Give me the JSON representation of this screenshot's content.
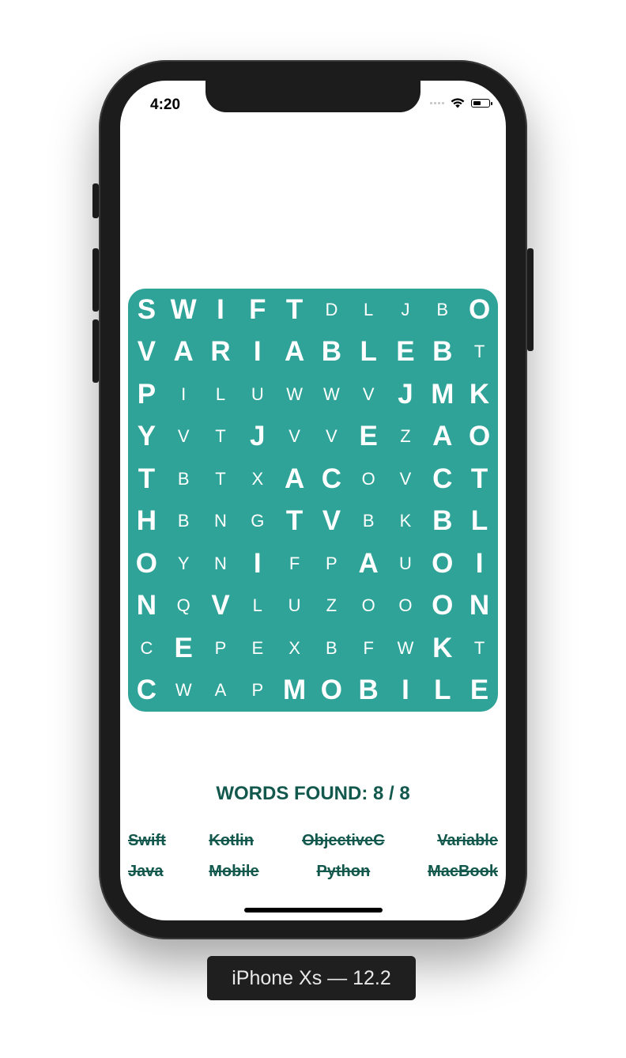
{
  "status_bar": {
    "time": "4:20"
  },
  "grid": [
    [
      {
        "l": "S",
        "f": true
      },
      {
        "l": "W",
        "f": true
      },
      {
        "l": "I",
        "f": true
      },
      {
        "l": "F",
        "f": true
      },
      {
        "l": "T",
        "f": true
      },
      {
        "l": "D",
        "f": false
      },
      {
        "l": "L",
        "f": false
      },
      {
        "l": "J",
        "f": false
      },
      {
        "l": "B",
        "f": false
      },
      {
        "l": "O",
        "f": true
      }
    ],
    [
      {
        "l": "V",
        "f": true
      },
      {
        "l": "A",
        "f": true
      },
      {
        "l": "R",
        "f": true
      },
      {
        "l": "I",
        "f": true
      },
      {
        "l": "A",
        "f": true
      },
      {
        "l": "B",
        "f": true
      },
      {
        "l": "L",
        "f": true
      },
      {
        "l": "E",
        "f": true
      },
      {
        "l": "B",
        "f": true
      },
      {
        "l": "T",
        "f": false
      }
    ],
    [
      {
        "l": "P",
        "f": true
      },
      {
        "l": "I",
        "f": false
      },
      {
        "l": "L",
        "f": false
      },
      {
        "l": "U",
        "f": false
      },
      {
        "l": "W",
        "f": false
      },
      {
        "l": "W",
        "f": false
      },
      {
        "l": "V",
        "f": false
      },
      {
        "l": "J",
        "f": true
      },
      {
        "l": "M",
        "f": true
      },
      {
        "l": "K",
        "f": true
      }
    ],
    [
      {
        "l": "Y",
        "f": true
      },
      {
        "l": "V",
        "f": false
      },
      {
        "l": "T",
        "f": false
      },
      {
        "l": "J",
        "f": true
      },
      {
        "l": "V",
        "f": false
      },
      {
        "l": "V",
        "f": false
      },
      {
        "l": "E",
        "f": true
      },
      {
        "l": "Z",
        "f": false
      },
      {
        "l": "A",
        "f": true
      },
      {
        "l": "O",
        "f": true
      }
    ],
    [
      {
        "l": "T",
        "f": true
      },
      {
        "l": "B",
        "f": false
      },
      {
        "l": "T",
        "f": false
      },
      {
        "l": "X",
        "f": false
      },
      {
        "l": "A",
        "f": true
      },
      {
        "l": "C",
        "f": true
      },
      {
        "l": "O",
        "f": false
      },
      {
        "l": "V",
        "f": false
      },
      {
        "l": "C",
        "f": true
      },
      {
        "l": "T",
        "f": true
      }
    ],
    [
      {
        "l": "H",
        "f": true
      },
      {
        "l": "B",
        "f": false
      },
      {
        "l": "N",
        "f": false
      },
      {
        "l": "G",
        "f": false
      },
      {
        "l": "T",
        "f": true
      },
      {
        "l": "V",
        "f": true
      },
      {
        "l": "B",
        "f": false
      },
      {
        "l": "K",
        "f": false
      },
      {
        "l": "B",
        "f": true
      },
      {
        "l": "L",
        "f": true
      }
    ],
    [
      {
        "l": "O",
        "f": true
      },
      {
        "l": "Y",
        "f": false
      },
      {
        "l": "N",
        "f": false
      },
      {
        "l": "I",
        "f": true
      },
      {
        "l": "F",
        "f": false
      },
      {
        "l": "P",
        "f": false
      },
      {
        "l": "A",
        "f": true
      },
      {
        "l": "U",
        "f": false
      },
      {
        "l": "O",
        "f": true
      },
      {
        "l": "I",
        "f": true
      }
    ],
    [
      {
        "l": "N",
        "f": true
      },
      {
        "l": "Q",
        "f": false
      },
      {
        "l": "V",
        "f": true
      },
      {
        "l": "L",
        "f": false
      },
      {
        "l": "U",
        "f": false
      },
      {
        "l": "Z",
        "f": false
      },
      {
        "l": "O",
        "f": false
      },
      {
        "l": "O",
        "f": false
      },
      {
        "l": "O",
        "f": true
      },
      {
        "l": "N",
        "f": true
      }
    ],
    [
      {
        "l": "C",
        "f": false
      },
      {
        "l": "E",
        "f": true
      },
      {
        "l": "P",
        "f": false
      },
      {
        "l": "E",
        "f": false
      },
      {
        "l": "X",
        "f": false
      },
      {
        "l": "B",
        "f": false
      },
      {
        "l": "F",
        "f": false
      },
      {
        "l": "W",
        "f": false
      },
      {
        "l": "K",
        "f": true
      },
      {
        "l": "T",
        "f": false
      }
    ],
    [
      {
        "l": "C",
        "f": true
      },
      {
        "l": "W",
        "f": false
      },
      {
        "l": "A",
        "f": false
      },
      {
        "l": "P",
        "f": false
      },
      {
        "l": "M",
        "f": true
      },
      {
        "l": "O",
        "f": true
      },
      {
        "l": "B",
        "f": true
      },
      {
        "l": "I",
        "f": true
      },
      {
        "l": "L",
        "f": true
      },
      {
        "l": "E",
        "f": true
      }
    ]
  ],
  "found_label": "WORDS FOUND: 8 / 8",
  "words": [
    "Swift",
    "Kotlin",
    "ObjectiveC",
    "Variable",
    "Java",
    "Mobile",
    "Python",
    "MacBook"
  ],
  "device_label": "iPhone Xs — 12.2",
  "colors": {
    "grid_bg": "#2fa398",
    "text_dark": "#13584d"
  }
}
